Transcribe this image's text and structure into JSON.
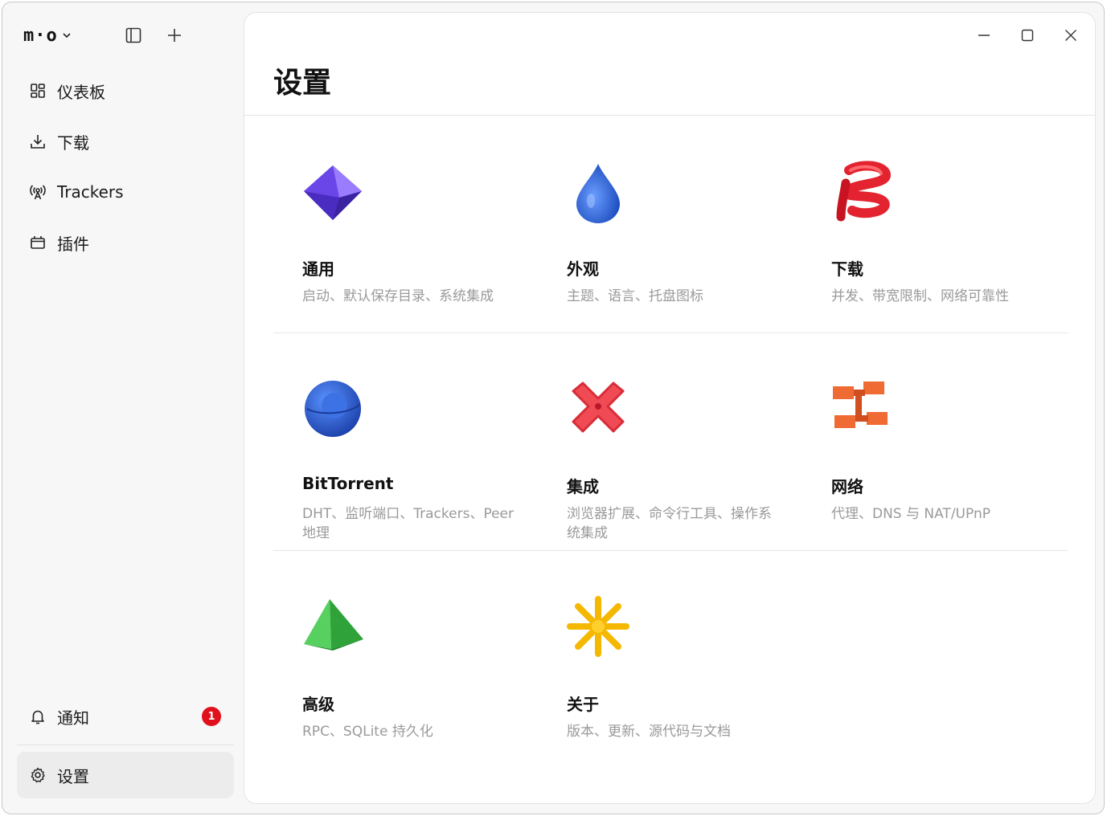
{
  "app": {
    "logo": "m·o"
  },
  "sidebar": {
    "items": [
      {
        "label": "仪表板",
        "icon": "dashboard-icon"
      },
      {
        "label": "下载",
        "icon": "download-icon"
      },
      {
        "label": "Trackers",
        "icon": "antenna-icon"
      },
      {
        "label": "插件",
        "icon": "plugin-icon"
      }
    ],
    "notifications": {
      "label": "通知",
      "count": "1",
      "icon": "bell-icon"
    },
    "settings": {
      "label": "设置",
      "icon": "gear-icon"
    }
  },
  "main": {
    "title": "设置",
    "cards": [
      {
        "title": "通用",
        "desc": "启动、默认保存目录、系统集成",
        "icon": "purple-octahedron-icon",
        "color": "#6a4cf0"
      },
      {
        "title": "外观",
        "desc": "主题、语言、托盘图标",
        "icon": "blue-drop-icon",
        "color": "#2e63d6"
      },
      {
        "title": "下载",
        "desc": "并发、带宽限制、网络可靠性",
        "icon": "red-coil-icon",
        "color": "#e3232f"
      },
      {
        "title": "BitTorrent",
        "desc": "DHT、监听端口、Trackers、Peer 地理",
        "icon": "blue-sphere-icon",
        "color": "#2f6ee0"
      },
      {
        "title": "集成",
        "desc": "浏览器扩展、命令行工具、操作系统集成",
        "icon": "red-x-icon",
        "color": "#f04b55"
      },
      {
        "title": "网络",
        "desc": "代理、DNS 与 NAT/UPnP",
        "icon": "orange-network-icon",
        "color": "#f06a34"
      },
      {
        "title": "高级",
        "desc": "RPC、SQLite 持久化",
        "icon": "green-pyramid-icon",
        "color": "#3fbf4a"
      },
      {
        "title": "关于",
        "desc": "版本、更新、源代码与文档",
        "icon": "yellow-star-icon",
        "color": "#f5b800"
      }
    ]
  }
}
